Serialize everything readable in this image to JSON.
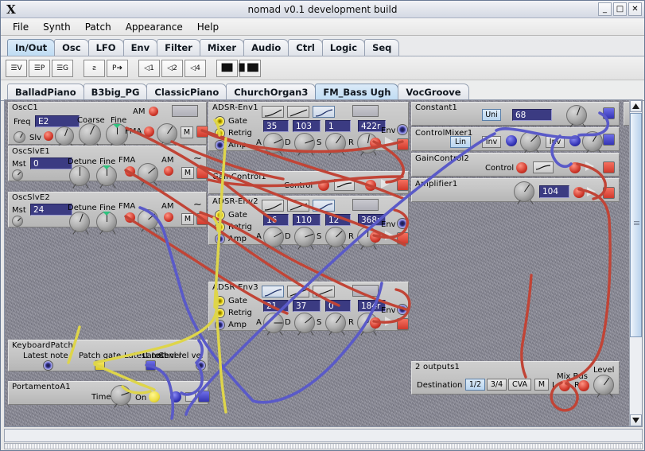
{
  "window": {
    "title": "nomad v0.1 development build",
    "logo": "X",
    "buttons": [
      {
        "name": "minimize-button",
        "glyph": "_"
      },
      {
        "name": "maximize-button",
        "glyph": "□"
      },
      {
        "name": "close-button",
        "glyph": "✕"
      }
    ]
  },
  "menubar": {
    "items": [
      "File",
      "Synth",
      "Patch",
      "Appearance",
      "Help"
    ]
  },
  "section_tabs": {
    "active": "In/Out",
    "items": [
      "In/Out",
      "Osc",
      "LFO",
      "Env",
      "Filter",
      "Mixer",
      "Audio",
      "Ctrl",
      "Logic",
      "Seq"
    ]
  },
  "toolbar": {
    "buttons": [
      {
        "name": "voice-list-button",
        "label": "☰V"
      },
      {
        "name": "patch-list-button",
        "label": "☰P"
      },
      {
        "name": "group-list-button",
        "label": "☰G"
      },
      {
        "name": "microphone-button",
        "label": "ƨ"
      },
      {
        "name": "patch-send-button",
        "label": "P➜"
      },
      {
        "name": "voices-1-button",
        "label": "◁1"
      },
      {
        "name": "voices-2-button",
        "label": "◁2"
      },
      {
        "name": "voices-4-button",
        "label": "◁4"
      },
      {
        "name": "keyboard-split-button",
        "label": "▐█▌"
      },
      {
        "name": "keyboard-button",
        "label": "█▐█▌"
      }
    ]
  },
  "patch_tabs": {
    "active": "FM_Bass Ugh",
    "items": [
      "BalladPiano",
      "B3big_PG",
      "ClassicPiano",
      "ChurchOrgan3",
      "FM_Bass Ugh",
      "VocGroove"
    ]
  },
  "modules": {
    "osc_c1": {
      "title": "OscC1",
      "freq_label": "Freq",
      "freq_value": "E2",
      "coarse_label": "Coarse",
      "fine_label": "Fine",
      "am_label": "AM",
      "fma_label": "FMA",
      "slv_label": "Slv",
      "m_label": "M"
    },
    "osc_slv_e1": {
      "title": "OscSlvE1",
      "mst_label": "Mst",
      "mst_value": "0",
      "detune_label": "Detune",
      "fine_label": "Fine",
      "fma_label": "FMA",
      "am_label": "AM",
      "m_label": "M"
    },
    "osc_slv_e2": {
      "title": "OscSlvE2",
      "mst_label": "Mst",
      "mst_value": "24",
      "detune_label": "Detune",
      "fine_label": "Fine",
      "fma_label": "FMA",
      "am_label": "AM",
      "m_label": "M"
    },
    "adsr_env1": {
      "title": "ADSR-Env1",
      "gate_label": "Gate",
      "retrig_label": "Retrig",
      "amp_label": "Amp",
      "a_label": "A",
      "d_label": "D",
      "s_label": "S",
      "r_label": "R",
      "a_value": "35",
      "d_value": "103",
      "s_value": "1",
      "r_value": "422r",
      "env_label": "Env",
      "shape_selected": 2
    },
    "gain_control1": {
      "title": "GainControl1",
      "control_label": "Control"
    },
    "adsr_env2": {
      "title": "ADSR-Env2",
      "gate_label": "Gate",
      "retrig_label": "Retrig",
      "amp_label": "Amp",
      "a_label": "A",
      "d_label": "D",
      "s_label": "S",
      "r_label": "R",
      "a_value": "16",
      "d_value": "110",
      "s_value": "12",
      "r_value": "368r",
      "env_label": "Env",
      "shape_selected": 2
    },
    "adsr_env3": {
      "title": "ADSR-Env3",
      "gate_label": "Gate",
      "retrig_label": "Retrig",
      "amp_label": "Amp",
      "a_label": "A",
      "d_label": "D",
      "s_label": "S",
      "r_label": "R",
      "a_value": "21",
      "d_value": "37",
      "s_value": "0",
      "r_value": "184r",
      "env_label": "Env",
      "shape_selected": 0
    },
    "constant1": {
      "title": "Constant1",
      "uni_label": "Uni",
      "value": "68"
    },
    "control_mixer1": {
      "title": "ControlMixer1",
      "lin_label": "Lin",
      "inv1_label": "Inv",
      "inv2_label": "Inv"
    },
    "gain_control2": {
      "title": "GainControl2",
      "control_label": "Control"
    },
    "amplifier1": {
      "title": "Amplifier1",
      "value": "104"
    },
    "keyboard_patch": {
      "title": "KeyboardPatch",
      "latest_note_label": "Latest note",
      "patch_gate_label": "Patch gate",
      "latest_note2_label": "Latest note",
      "latest_vel_label": "Latest vel",
      "chnl_rel_vel_label": "Chnl rel vel"
    },
    "portamento_a1": {
      "title": "PortamentoA1",
      "time_label": "Time",
      "on_label": "On"
    },
    "outputs1": {
      "title": "2 outputs1",
      "destination_label": "Destination",
      "dest_options": [
        "1/2",
        "3/4",
        "CVA",
        "M"
      ],
      "dest_selected": "1/2",
      "mix_bus_label": "Mix Bus",
      "l_label": "L",
      "r_label": "R",
      "level_label": "Level"
    }
  },
  "colors": {
    "cable_red": "#d9483c",
    "cable_blue": "#6a6ad0",
    "cable_yellow": "#e8df4a",
    "panel": "#c4c4c4",
    "canvas_bg": "#8b8b98",
    "field_bg": "#3b3b82",
    "tab_active": "#bfdcf3"
  }
}
